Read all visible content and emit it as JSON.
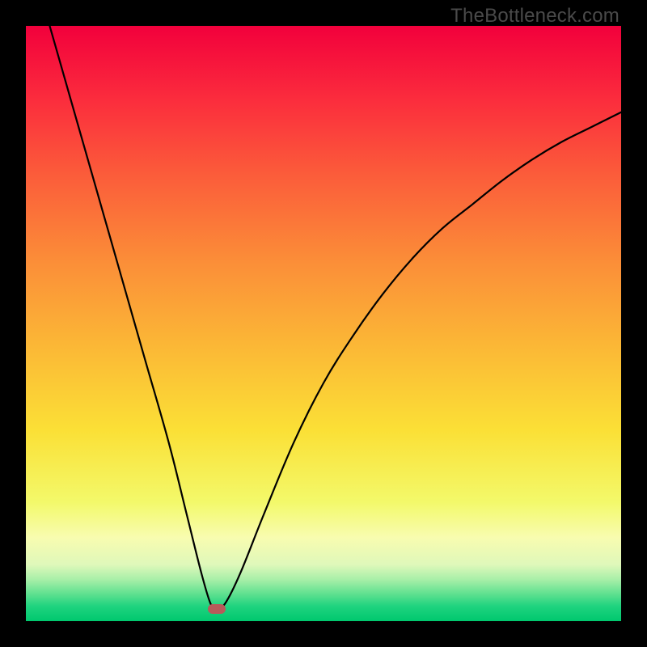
{
  "watermark": "TheBottleneck.com",
  "chart_data": {
    "type": "line",
    "title": "",
    "xlabel": "",
    "ylabel": "",
    "xlim": [
      0,
      100
    ],
    "ylim": [
      0,
      100
    ],
    "grid": false,
    "legend": false,
    "series": [
      {
        "name": "bottleneck-curve",
        "x": [
          4,
          8,
          12,
          16,
          20,
          24,
          27,
          29.5,
          31,
          32,
          33.5,
          36,
          40,
          45,
          50,
          55,
          60,
          65,
          70,
          75,
          80,
          85,
          90,
          95,
          100
        ],
        "y": [
          100,
          86,
          72,
          58,
          44,
          30,
          18,
          8,
          3,
          2,
          3,
          8,
          18,
          30,
          40,
          48,
          55,
          61,
          66,
          70,
          74,
          77.5,
          80.5,
          83,
          85.5
        ]
      }
    ],
    "annotations": [
      {
        "name": "min-marker",
        "x": 32,
        "y": 2,
        "color": "#b85a5a"
      }
    ],
    "background_gradient": {
      "stops": [
        {
          "pos": 0.0,
          "color": "#f2003c"
        },
        {
          "pos": 0.12,
          "color": "#fb2b3d"
        },
        {
          "pos": 0.25,
          "color": "#fb5c3a"
        },
        {
          "pos": 0.4,
          "color": "#fb8f38"
        },
        {
          "pos": 0.55,
          "color": "#fbbb36"
        },
        {
          "pos": 0.68,
          "color": "#fbe036"
        },
        {
          "pos": 0.8,
          "color": "#f3f96a"
        },
        {
          "pos": 0.86,
          "color": "#f8fcb0"
        },
        {
          "pos": 0.905,
          "color": "#dff8ba"
        },
        {
          "pos": 0.93,
          "color": "#a8efa8"
        },
        {
          "pos": 0.955,
          "color": "#5de08f"
        },
        {
          "pos": 0.975,
          "color": "#1fd37f"
        },
        {
          "pos": 1.0,
          "color": "#00c86e"
        }
      ]
    },
    "curve_stroke": "#000000",
    "curve_width": 2.2
  }
}
